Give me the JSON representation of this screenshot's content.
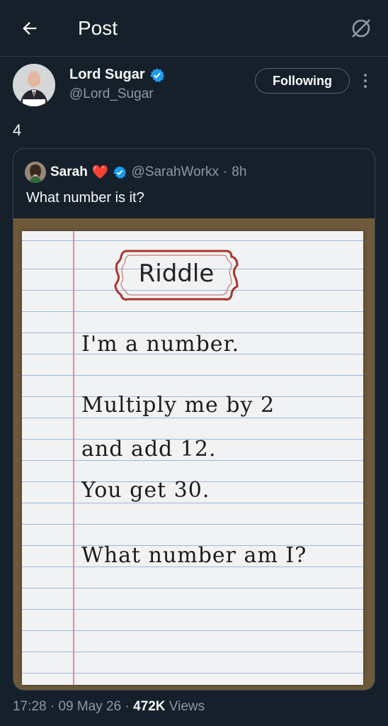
{
  "header": {
    "title": "Post",
    "back_icon": "arrow-left-icon",
    "right_icon": "grok-icon"
  },
  "author": {
    "name": "Lord Sugar",
    "handle": "@Lord_Sugar",
    "verified": true,
    "follow_label": "Following"
  },
  "tweet": {
    "text": "4"
  },
  "quoted": {
    "name": "Sarah",
    "emoji": "❤️",
    "handle": "@SarahWorkx",
    "separator": "·",
    "time": "8h",
    "text": "What number is it?",
    "image_lines": {
      "title": "Riddle",
      "line1": "I'm a number.",
      "line2": "Multiply me by 2",
      "line3": "and add 12.",
      "line4": "You get 30.",
      "line5": "What number am I?"
    }
  },
  "footer": {
    "time": "17:28",
    "date": "09 May 26",
    "separator": "·",
    "views_count": "472K",
    "views_label": "Views"
  },
  "colors": {
    "background": "#15202b",
    "verified": "#1d9bf0",
    "muted": "#8b98a5"
  }
}
